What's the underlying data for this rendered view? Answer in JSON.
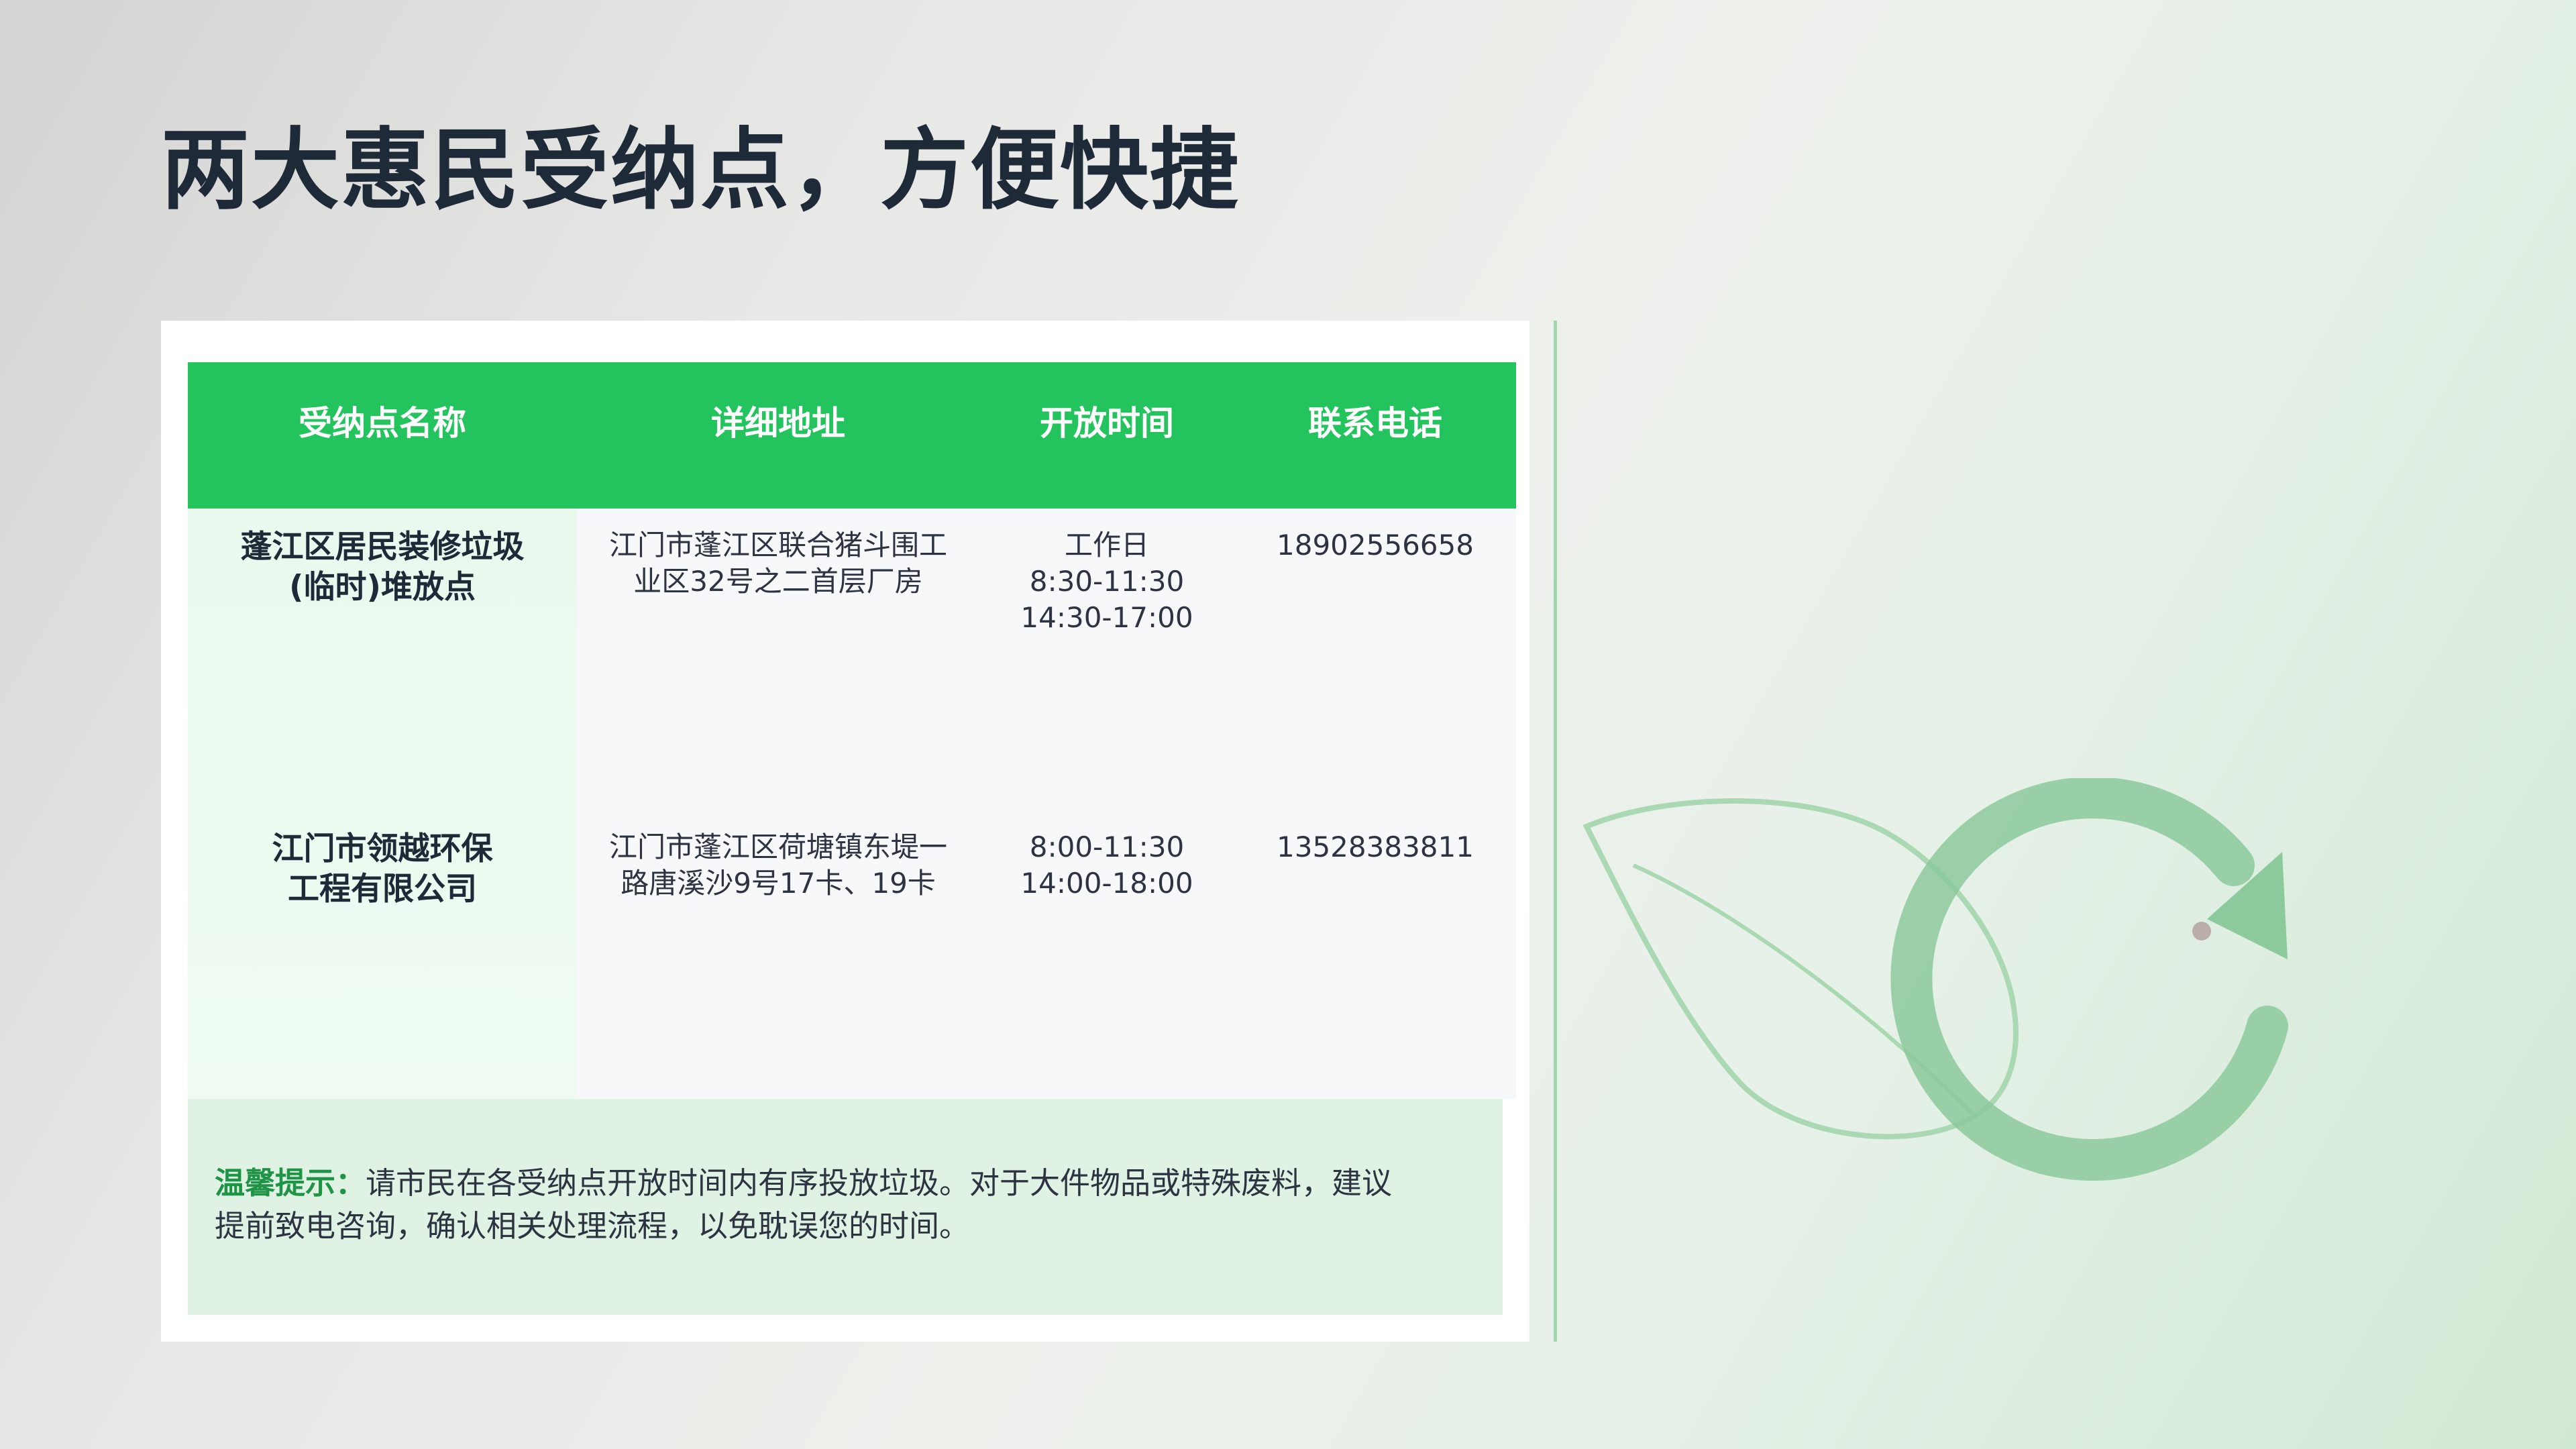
{
  "slide": {
    "title": "两大惠民受纳点，方便快捷"
  },
  "table": {
    "headers": [
      "受纳点名称",
      "详细地址",
      "开放时间",
      "联系电话"
    ],
    "rows": [
      {
        "name": [
          "蓬江区居民装修垃圾",
          "(临时)堆放点"
        ],
        "address": [
          "江门市蓬江区联合猪斗围工",
          "业区32号之二首层厂房"
        ],
        "hours": [
          "工作日",
          "8:30-11:30",
          "14:30-17:00"
        ],
        "phone": "18902556658"
      },
      {
        "name": [
          "江门市领越环保",
          "工程有限公司"
        ],
        "address": [
          "江门市蓬江区荷塘镇东堤一",
          "路唐溪沙9号17卡、19卡"
        ],
        "hours": [
          "8:00-11:30",
          "14:00-18:00"
        ],
        "phone": "13528383811"
      }
    ]
  },
  "notice": {
    "label": "温馨提示：",
    "line1": "请市民在各受纳点开放时间内有序投放垃圾。对于大件物品或特殊废料，建议",
    "line2": "提前致电咨询，确认相关处理流程，以免耽误您的时间。"
  },
  "decoration": {
    "icon": "leaf-recycle-icon",
    "colors": {
      "accent": "#23c45e",
      "leaf": "#a9d8b2",
      "arrow": "#8cc99b"
    }
  }
}
